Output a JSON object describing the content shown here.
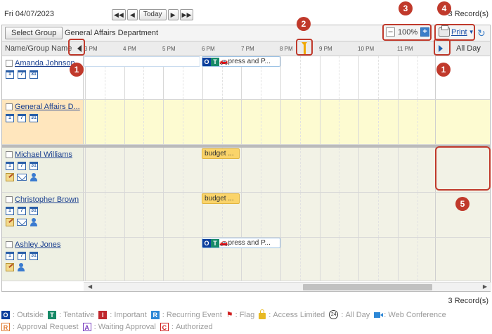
{
  "toolbar": {
    "date": "Fri 04/07/2023",
    "prev_week": "◀◀",
    "prev_day": "◀",
    "today": "Today",
    "next_day": "▶",
    "next_week": "▶▶",
    "records_top": "3 Record(s)"
  },
  "group": {
    "select_label": "Select Group",
    "name": "General Affairs Department",
    "zoom_minus": "–",
    "zoom": "100%",
    "zoom_plus": "+",
    "print": "Print",
    "refresh": "↻"
  },
  "header": {
    "name_col": "Name/Group Name",
    "all_day": "All Day",
    "ticks": [
      "3 PM",
      "4 PM",
      "5 PM",
      "6 PM",
      "7 PM",
      "8 PM",
      "9 PM",
      "10 PM",
      "11 PM"
    ]
  },
  "rows": [
    {
      "name": "Amanda Johnson",
      "events": [
        {
          "text": "press and P..."
        }
      ]
    },
    {
      "name": "General Affairs D..."
    },
    {
      "name": "Michael Williams",
      "events": [
        {
          "text": "budget ..."
        }
      ]
    },
    {
      "name": "Christopher Brown",
      "events": [
        {
          "text": "budget ..."
        }
      ]
    },
    {
      "name": "Ashley Jones",
      "events": [
        {
          "text": "press and P..."
        }
      ]
    }
  ],
  "cal_icons": [
    "1",
    "7",
    "31"
  ],
  "callouts": [
    "1",
    "2",
    "3",
    "4",
    "1",
    "5"
  ],
  "records_bottom": "3 Record(s)",
  "legend": {
    "outside": "Outside",
    "tentative": "Tentative",
    "important": "Important",
    "recurring": "Recurring Event",
    "flag": "Flag",
    "access": "Access Limited",
    "allday": "All Day",
    "webconf": "Web Conference",
    "approval_request": "Approval Request",
    "waiting": "Waiting Approval",
    "authorized": "Authorized",
    "badges": {
      "O": "O",
      "T": "T",
      "I": "I",
      "R": "R",
      "A": "R",
      "W": "A",
      "C": "C"
    },
    "sep": ":"
  }
}
